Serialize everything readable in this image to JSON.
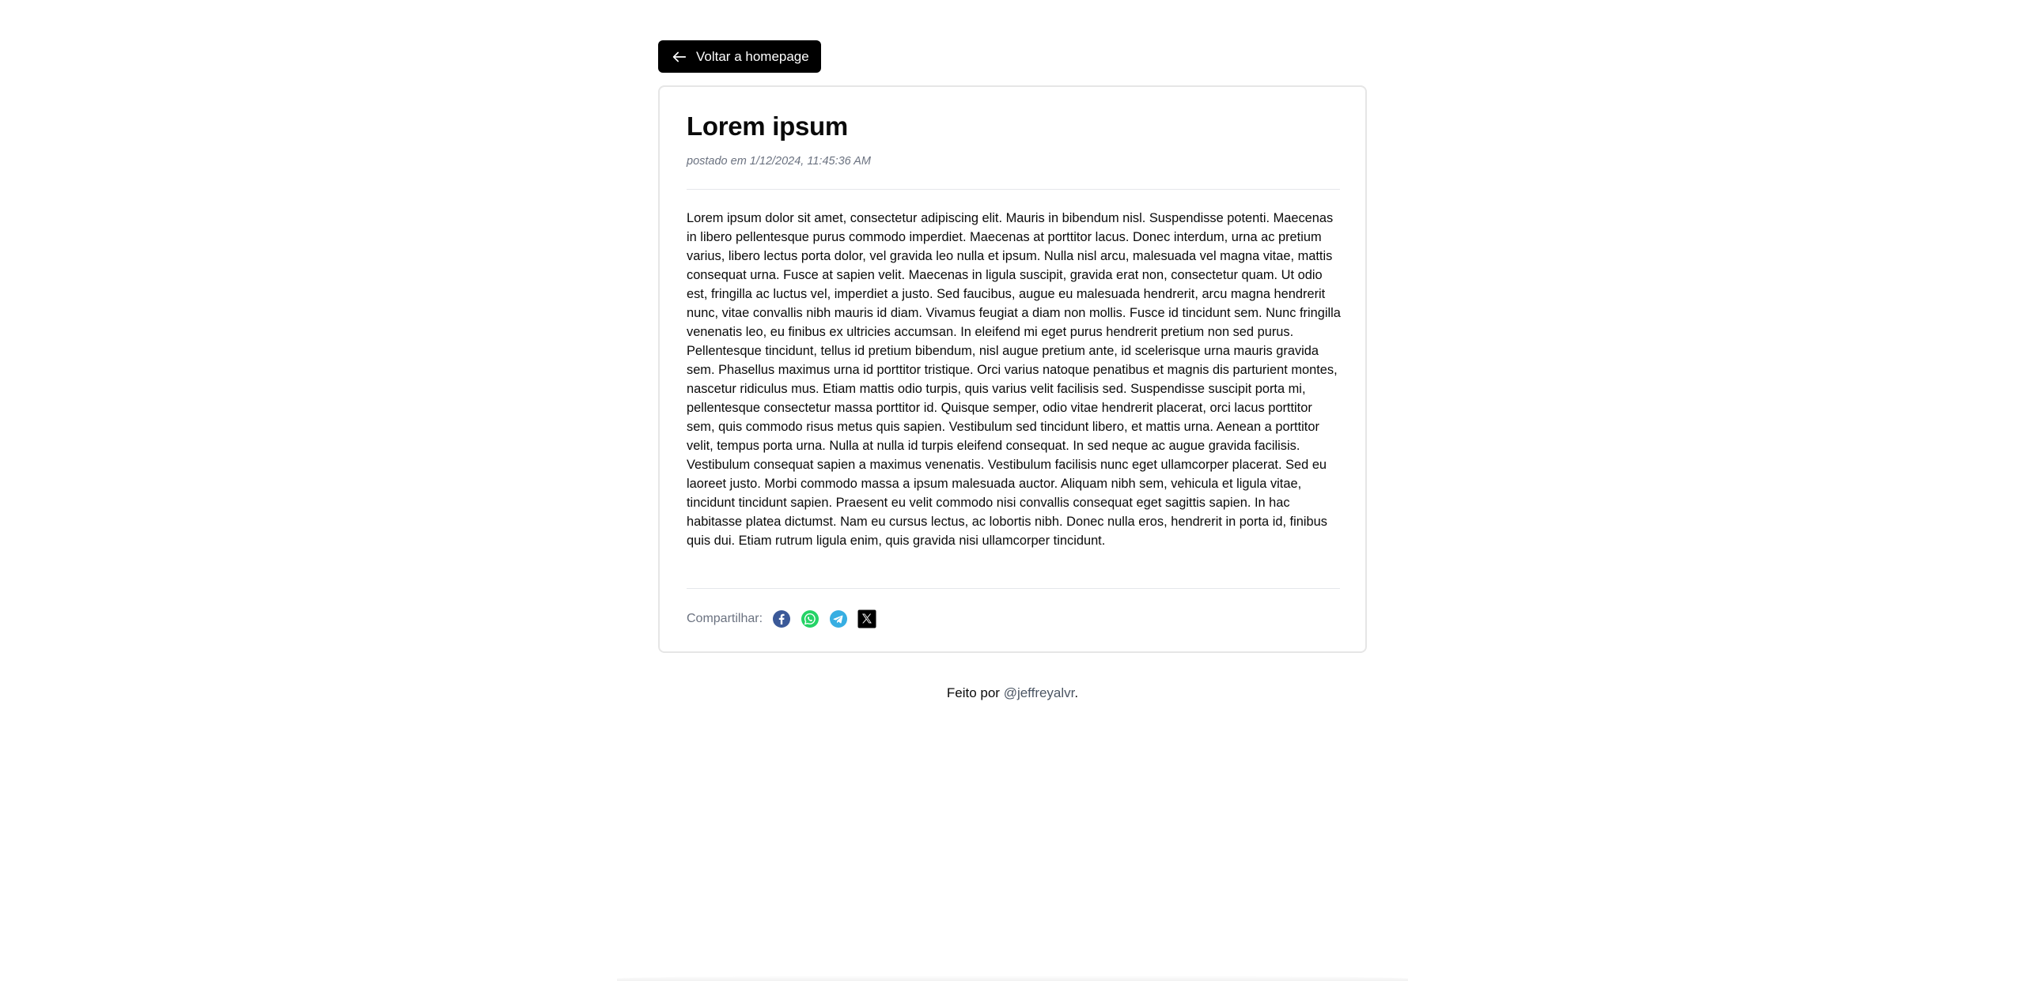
{
  "nav": {
    "back_label": "Voltar a homepage",
    "back_icon": "arrow-left-icon"
  },
  "post": {
    "title": "Lorem ipsum",
    "posted_at": "postado em 1/12/2024, 11:45:36 AM",
    "body": "Lorem ipsum dolor sit amet, consectetur adipiscing elit. Mauris in bibendum nisl. Suspendisse potenti. Maecenas in libero pellentesque purus commodo imperdiet. Maecenas at porttitor lacus. Donec interdum, urna ac pretium varius, libero lectus porta dolor, vel gravida leo nulla et ipsum. Nulla nisl arcu, malesuada vel magna vitae, mattis consequat urna. Fusce at sapien velit. Maecenas in ligula suscipit, gravida erat non, consectetur quam. Ut odio est, fringilla ac luctus vel, imperdiet a justo. Sed faucibus, augue eu malesuada hendrerit, arcu magna hendrerit nunc, vitae convallis nibh mauris id diam.  Vivamus feugiat a diam non mollis. Fusce id tincidunt sem. Nunc fringilla venenatis leo, eu finibus ex ultricies accumsan. In eleifend mi eget purus hendrerit pretium non sed purus. Pellentesque tincidunt, tellus id pretium bibendum, nisl augue pretium ante, id scelerisque urna mauris gravida sem. Phasellus maximus urna id porttitor tristique. Orci varius natoque penatibus et magnis dis parturient montes, nascetur ridiculus mus. Etiam mattis odio turpis, quis varius velit facilisis sed. Suspendisse suscipit porta mi, pellentesque consectetur massa porttitor id. Quisque semper, odio vitae hendrerit placerat, orci lacus porttitor sem, quis commodo risus metus quis sapien. Vestibulum sed tincidunt libero, et mattis urna. Aenean a porttitor velit, tempus porta urna. Nulla at nulla id turpis eleifend consequat. In sed neque ac augue gravida facilisis. Vestibulum consequat sapien a maximus venenatis. Vestibulum facilisis nunc eget ullamcorper placerat. Sed eu laoreet justo. Morbi commodo massa a ipsum malesuada auctor. Aliquam nibh sem, vehicula et ligula vitae, tincidunt tincidunt sapien. Praesent eu velit commodo nisi convallis consequat eget sagittis sapien. In hac habitasse platea dictumst. Nam eu cursus lectus, ac lobortis nibh. Donec nulla eros, hendrerit in porta id, finibus quis dui. Etiam rutrum ligula enim, quis gravida nisi ullamcorper tincidunt."
  },
  "share": {
    "label": "Compartilhar:",
    "icons": [
      "facebook-icon",
      "whatsapp-icon",
      "telegram-icon",
      "x-icon"
    ],
    "colors": {
      "facebook": "#3b5998",
      "whatsapp": "#25d366",
      "telegram": "#37aee2",
      "x": "#000000"
    }
  },
  "footer": {
    "prefix": "Feito por ",
    "author_link": "@jeffreyalvr",
    "suffix": "."
  }
}
